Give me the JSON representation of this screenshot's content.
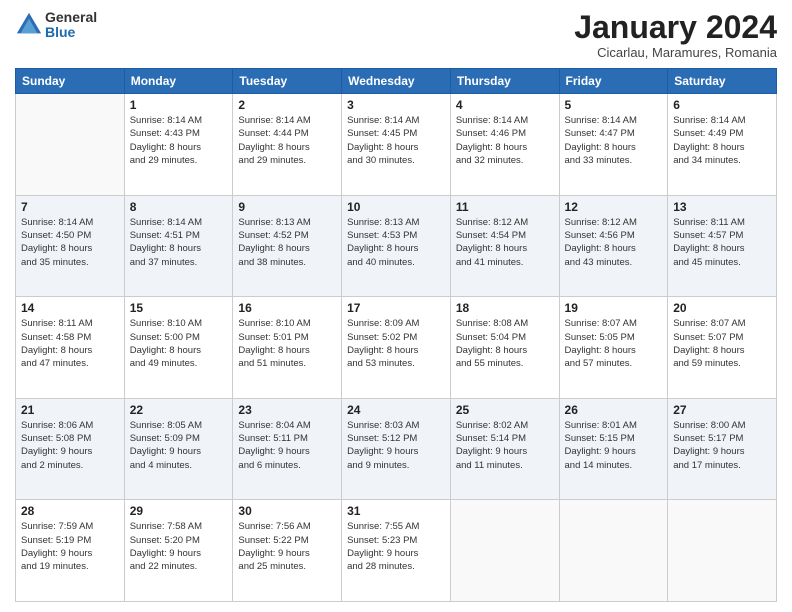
{
  "header": {
    "logo_general": "General",
    "logo_blue": "Blue",
    "month_title": "January 2024",
    "location": "Cicarlau, Maramures, Romania"
  },
  "weekdays": [
    "Sunday",
    "Monday",
    "Tuesday",
    "Wednesday",
    "Thursday",
    "Friday",
    "Saturday"
  ],
  "weeks": [
    [
      {
        "day": "",
        "info": ""
      },
      {
        "day": "1",
        "info": "Sunrise: 8:14 AM\nSunset: 4:43 PM\nDaylight: 8 hours\nand 29 minutes."
      },
      {
        "day": "2",
        "info": "Sunrise: 8:14 AM\nSunset: 4:44 PM\nDaylight: 8 hours\nand 29 minutes."
      },
      {
        "day": "3",
        "info": "Sunrise: 8:14 AM\nSunset: 4:45 PM\nDaylight: 8 hours\nand 30 minutes."
      },
      {
        "day": "4",
        "info": "Sunrise: 8:14 AM\nSunset: 4:46 PM\nDaylight: 8 hours\nand 32 minutes."
      },
      {
        "day": "5",
        "info": "Sunrise: 8:14 AM\nSunset: 4:47 PM\nDaylight: 8 hours\nand 33 minutes."
      },
      {
        "day": "6",
        "info": "Sunrise: 8:14 AM\nSunset: 4:49 PM\nDaylight: 8 hours\nand 34 minutes."
      }
    ],
    [
      {
        "day": "7",
        "info": "Sunrise: 8:14 AM\nSunset: 4:50 PM\nDaylight: 8 hours\nand 35 minutes."
      },
      {
        "day": "8",
        "info": "Sunrise: 8:14 AM\nSunset: 4:51 PM\nDaylight: 8 hours\nand 37 minutes."
      },
      {
        "day": "9",
        "info": "Sunrise: 8:13 AM\nSunset: 4:52 PM\nDaylight: 8 hours\nand 38 minutes."
      },
      {
        "day": "10",
        "info": "Sunrise: 8:13 AM\nSunset: 4:53 PM\nDaylight: 8 hours\nand 40 minutes."
      },
      {
        "day": "11",
        "info": "Sunrise: 8:12 AM\nSunset: 4:54 PM\nDaylight: 8 hours\nand 41 minutes."
      },
      {
        "day": "12",
        "info": "Sunrise: 8:12 AM\nSunset: 4:56 PM\nDaylight: 8 hours\nand 43 minutes."
      },
      {
        "day": "13",
        "info": "Sunrise: 8:11 AM\nSunset: 4:57 PM\nDaylight: 8 hours\nand 45 minutes."
      }
    ],
    [
      {
        "day": "14",
        "info": "Sunrise: 8:11 AM\nSunset: 4:58 PM\nDaylight: 8 hours\nand 47 minutes."
      },
      {
        "day": "15",
        "info": "Sunrise: 8:10 AM\nSunset: 5:00 PM\nDaylight: 8 hours\nand 49 minutes."
      },
      {
        "day": "16",
        "info": "Sunrise: 8:10 AM\nSunset: 5:01 PM\nDaylight: 8 hours\nand 51 minutes."
      },
      {
        "day": "17",
        "info": "Sunrise: 8:09 AM\nSunset: 5:02 PM\nDaylight: 8 hours\nand 53 minutes."
      },
      {
        "day": "18",
        "info": "Sunrise: 8:08 AM\nSunset: 5:04 PM\nDaylight: 8 hours\nand 55 minutes."
      },
      {
        "day": "19",
        "info": "Sunrise: 8:07 AM\nSunset: 5:05 PM\nDaylight: 8 hours\nand 57 minutes."
      },
      {
        "day": "20",
        "info": "Sunrise: 8:07 AM\nSunset: 5:07 PM\nDaylight: 8 hours\nand 59 minutes."
      }
    ],
    [
      {
        "day": "21",
        "info": "Sunrise: 8:06 AM\nSunset: 5:08 PM\nDaylight: 9 hours\nand 2 minutes."
      },
      {
        "day": "22",
        "info": "Sunrise: 8:05 AM\nSunset: 5:09 PM\nDaylight: 9 hours\nand 4 minutes."
      },
      {
        "day": "23",
        "info": "Sunrise: 8:04 AM\nSunset: 5:11 PM\nDaylight: 9 hours\nand 6 minutes."
      },
      {
        "day": "24",
        "info": "Sunrise: 8:03 AM\nSunset: 5:12 PM\nDaylight: 9 hours\nand 9 minutes."
      },
      {
        "day": "25",
        "info": "Sunrise: 8:02 AM\nSunset: 5:14 PM\nDaylight: 9 hours\nand 11 minutes."
      },
      {
        "day": "26",
        "info": "Sunrise: 8:01 AM\nSunset: 5:15 PM\nDaylight: 9 hours\nand 14 minutes."
      },
      {
        "day": "27",
        "info": "Sunrise: 8:00 AM\nSunset: 5:17 PM\nDaylight: 9 hours\nand 17 minutes."
      }
    ],
    [
      {
        "day": "28",
        "info": "Sunrise: 7:59 AM\nSunset: 5:19 PM\nDaylight: 9 hours\nand 19 minutes."
      },
      {
        "day": "29",
        "info": "Sunrise: 7:58 AM\nSunset: 5:20 PM\nDaylight: 9 hours\nand 22 minutes."
      },
      {
        "day": "30",
        "info": "Sunrise: 7:56 AM\nSunset: 5:22 PM\nDaylight: 9 hours\nand 25 minutes."
      },
      {
        "day": "31",
        "info": "Sunrise: 7:55 AM\nSunset: 5:23 PM\nDaylight: 9 hours\nand 28 minutes."
      },
      {
        "day": "",
        "info": ""
      },
      {
        "day": "",
        "info": ""
      },
      {
        "day": "",
        "info": ""
      }
    ]
  ]
}
